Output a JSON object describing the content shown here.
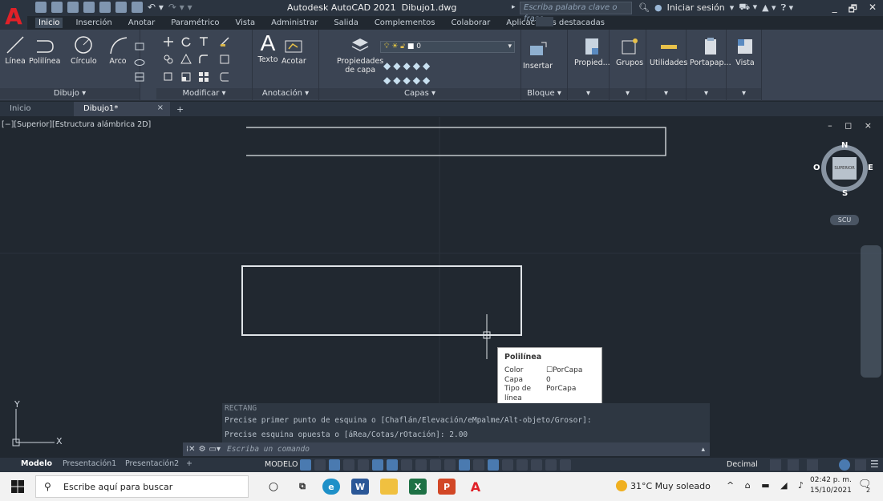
{
  "title": {
    "app_title": "Autodesk AutoCAD 2021",
    "file_name": "Dibujo1.dwg",
    "search_placeholder": "Escriba palabra clave o frase",
    "sign_in": "Iniciar sesión"
  },
  "ribbon_tabs": [
    "Inicio",
    "Inserción",
    "Anotar",
    "Paramétrico",
    "Vista",
    "Administrar",
    "Salida",
    "Complementos",
    "Colaborar",
    "Aplicaciones destacadas"
  ],
  "ribbon": {
    "dibujo": {
      "title": "Dibujo ▾",
      "tools": [
        "Línea",
        "Polilínea",
        "Círculo",
        "Arco"
      ]
    },
    "modificar": {
      "title": "Modificar ▾"
    },
    "anotacion": {
      "title": "Anotación ▾",
      "tools": [
        "Texto",
        "Acotar"
      ]
    },
    "capas": {
      "title": "Capas ▾",
      "tool": "Propiedades de capa",
      "tool_line1": "Propiedades",
      "tool_line2": "de capa",
      "layer_value": "0"
    },
    "bloque": {
      "title": "Bloque ▾",
      "tool": "Insertar"
    },
    "extras": [
      "Propied...",
      "Grupos",
      "Utilidades",
      "Portapap...",
      "Vista"
    ]
  },
  "doc_tabs": {
    "home": "Inicio",
    "active": "Dibujo1*",
    "close": "×",
    "add": "+"
  },
  "viewport": {
    "label": "[−][Superior][Estructura alámbrica 2D]",
    "window_controls": "– ◻ ×",
    "viewcube": {
      "n": "N",
      "s": "S",
      "e": "E",
      "w": "O",
      "face": "SUPERIOR"
    },
    "ucs_label": "SCU"
  },
  "tooltip": {
    "title": "Polilínea",
    "rows": [
      {
        "k": "Color",
        "v": "☐PorCapa"
      },
      {
        "k": "Capa",
        "v": "0"
      },
      {
        "k": "Tipo de línea",
        "v": "PorCapa"
      }
    ]
  },
  "command": {
    "history0": "RECTANG",
    "history1": "Precise primer punto de esquina o [Chaflán/Elevación/eMpalme/Alt-objeto/Grosor]:",
    "history2": "Precise esquina opuesta o [áRea/Cotas/rOtación]: 2.00",
    "placeholder": "Escriba un comando"
  },
  "ucs_icon": {
    "y": "Y",
    "x": "X"
  },
  "layout_tabs": [
    "Modelo",
    "Presentación1",
    "Presentación2"
  ],
  "status": {
    "model": "MODELO",
    "units": "Decimal"
  },
  "taskbar": {
    "search": "Escribe aquí para buscar",
    "weather": "31°C  Muy soleado",
    "time": "02:42 p. m.",
    "date": "15/10/2021",
    "notifications": "2"
  },
  "colors": {
    "autocad_red": "#e02128",
    "canvas": "#212830",
    "ribbon": "#3b4453",
    "rect_stroke": "#e0e4e8"
  }
}
